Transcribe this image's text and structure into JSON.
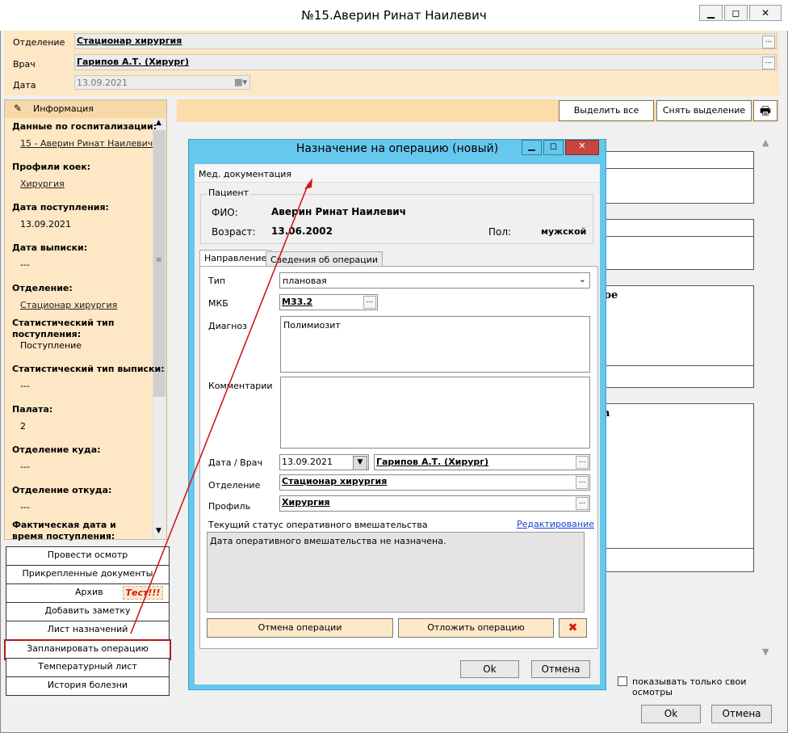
{
  "window": {
    "title": "№15.Аверин Ринат Наилевич",
    "min": "▁",
    "max": "◻",
    "close": "✕"
  },
  "form": {
    "dept_label": "Отделение",
    "dept_value": "Стационар хирургия",
    "doctor_label": "Врач",
    "doctor_value": "Гарипов А.Т. (Хирург)",
    "date_label": "Дата",
    "date_value": "13.09.2021",
    "ellipsis": "..."
  },
  "left": {
    "header": "Информация",
    "items": [
      {
        "label": "Данные по госпитализации:",
        "value": "15 - Аверин Ринат Наилевич",
        "link": true
      },
      {
        "label": "Профили коек:",
        "value": "Хирургия",
        "link": true
      },
      {
        "label": "Дата поступления:",
        "value": "13.09.2021",
        "link": false
      },
      {
        "label": "Дата выписки:",
        "value": "---",
        "link": false
      },
      {
        "label": "Отделение:",
        "value": "Стационар хирургия",
        "link": true
      }
    ],
    "stat_in_label": "Статистический тип поступления:",
    "stat_in_value": "Поступление",
    "stat_out_label": "Статистический тип выписки:",
    "stat_out_value": "---",
    "ward_label": "Палата:",
    "ward_value": "2",
    "dept_to_label": "Отделение куда:",
    "dept_to_value": "---",
    "dept_from_label": "Отделение откуда:",
    "dept_from_value": "---",
    "actual_label": "Фактическая дата и время поступления:"
  },
  "buttons": {
    "exam": "Провести осмотр",
    "docs": "Прикрепленные документы",
    "archive": "Архив",
    "test": "Тест!!!",
    "note": "Добавить заметку",
    "prescriptions": "Лист назначений",
    "plan_op": "Запланировать операцию",
    "temp": "Температурный лист",
    "history": "История болезни"
  },
  "right": {
    "select_all": "Выделить все",
    "deselect": "Снять выделение",
    "frag1": "кое",
    "frag2": "та",
    "show_own": "показывать только свои осмотры",
    "ok": "Ok",
    "cancel": "Отмена"
  },
  "dialog": {
    "title": "Назначение на операцию (новый)",
    "menu": "Мед. документация",
    "patient_group": "Пациент",
    "fio_label": "ФИО:",
    "fio_value": "Аверин Ринат Наилевич",
    "age_label": "Возраст:",
    "age_value": "13.06.2002",
    "sex_label": "Пол:",
    "sex_value": "мужской",
    "tab1": "Направление",
    "tab2": "Сведения об операции",
    "type_label": "Тип",
    "type_value": "плановая",
    "mkb_label": "МКБ",
    "mkb_value": "M33.2",
    "diag_label": "Диагноз",
    "diag_value": "Полимиозит",
    "comment_label": "Комментарии",
    "datedoc_label": "Дата / Врач",
    "date_value": "13.09.2021",
    "doctor_value": "Гарипов А.Т. (Хирург)",
    "dept_label": "Отделение",
    "dept_value": "Стационар хирургия",
    "profile_label": "Профиль",
    "profile_value": "Хирургия",
    "status_label": "Текущий статус оперативного вмешательства",
    "edit_link": "Редактирование",
    "status_text": "Дата оперативного вмешательства не назначена.",
    "cancel_op": "Отмена операции",
    "postpone_op": "Отложить операцию",
    "ok": "Ok",
    "cancel": "Отмена"
  },
  "colors": {
    "accent": "#66c8ec",
    "form_bg": "#fde7c4",
    "arrow": "#d11a1a"
  }
}
